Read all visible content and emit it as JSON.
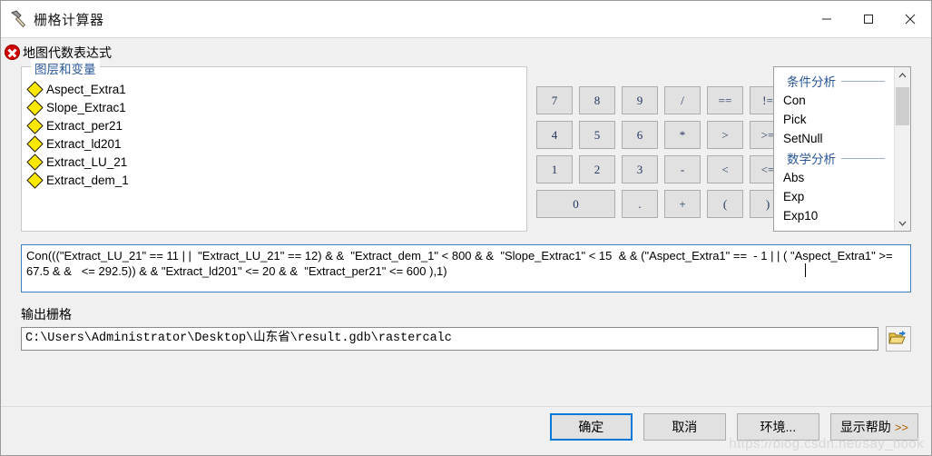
{
  "window": {
    "title": "栅格计算器",
    "icon": "hammer-icon",
    "controls": {
      "minimize": "—",
      "maximize": "☐",
      "close": "✕"
    }
  },
  "error_header": {
    "icon": "error-circle-icon",
    "label": "地图代数表达式"
  },
  "layers_panel": {
    "title": "图层和变量",
    "items": [
      {
        "name": "Aspect_Extra1",
        "icon": "yellow-diamond-icon"
      },
      {
        "name": "Slope_Extrac1",
        "icon": "yellow-diamond-icon"
      },
      {
        "name": "Extract_per21",
        "icon": "yellow-diamond-icon"
      },
      {
        "name": "Extract_ld201",
        "icon": "yellow-diamond-icon"
      },
      {
        "name": "Extract_LU_21",
        "icon": "yellow-diamond-icon"
      },
      {
        "name": "Extract_dem_1",
        "icon": "yellow-diamond-icon"
      }
    ]
  },
  "keypad": {
    "rows": [
      [
        "7",
        "8",
        "9",
        "/",
        "==",
        "!=",
        "&"
      ],
      [
        "4",
        "5",
        "6",
        "*",
        ">",
        ">=",
        "|"
      ],
      [
        "1",
        "2",
        "3",
        "-",
        "<",
        "<=",
        "^"
      ],
      [
        "0",
        ".",
        "+",
        "(",
        ")",
        "~"
      ]
    ]
  },
  "function_panel": {
    "groups": [
      {
        "title": "条件分析",
        "items": [
          "Con",
          "Pick",
          "SetNull"
        ]
      },
      {
        "title": "数学分析",
        "items": [
          "Abs",
          "Exp",
          "Exp10"
        ]
      }
    ],
    "scroll_up": "⌃",
    "scroll_down": "⌄"
  },
  "expression": {
    "value": "Con(((\"Extract_LU_21\" == 11 | |  \"Extract_LU_21\" == 12) & &  \"Extract_dem_1\" < 800 & &  \"Slope_Extrac1\" < 15  & & (\"Aspect_Extra1\" ==  - 1 | | ( \"Aspect_Extra1\" >= 67.5 & &   <= 292.5)) & & \"Extract_ld201\" <= 20 & &  \"Extract_per21\" <= 600 ),1)"
  },
  "output": {
    "label": "输出栅格",
    "path": "C:\\Users\\Administrator\\Desktop\\山东省\\result.gdb\\rastercalc",
    "browse_icon": "open-folder-icon"
  },
  "footer": {
    "buttons": [
      {
        "label": "确定",
        "default": true,
        "chevron": ""
      },
      {
        "label": "取消",
        "default": false,
        "chevron": ""
      },
      {
        "label": "环境...",
        "default": false,
        "chevron": ""
      },
      {
        "label": "显示帮助",
        "default": false,
        "chevron": ">>"
      }
    ]
  },
  "watermark": "https://blog.csdn.net/say_book",
  "colors": {
    "accent": "#0078d7",
    "group_title": "#2b5797",
    "error": "#d10000",
    "diamond": "#ffe800",
    "dialog_bg": "#f0f0f0"
  }
}
